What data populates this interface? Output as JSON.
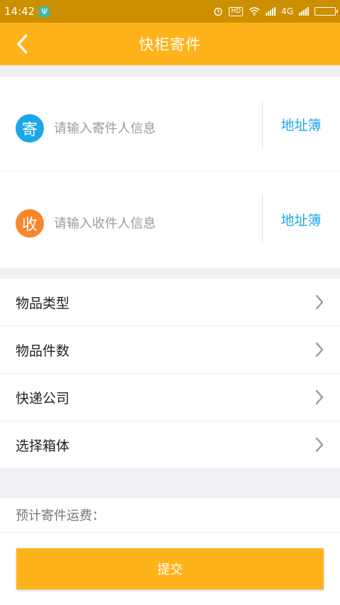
{
  "status_bar": {
    "time": "14:42",
    "hd_badge": "HD",
    "network": "4G",
    "icons": [
      "usb-icon",
      "alarm-icon",
      "hd-icon",
      "wifi-icon",
      "signal-icon",
      "signal-icon",
      "battery-charging-icon"
    ]
  },
  "nav": {
    "title": "快柜寄件",
    "back_icon": "chevron-left-icon"
  },
  "sender": {
    "badge": "寄",
    "placeholder": "请输入寄件人信息",
    "address_book": "地址簿",
    "color": "#1ba7ea"
  },
  "receiver": {
    "badge": "收",
    "placeholder": "请输入收件人信息",
    "address_book": "地址簿",
    "color": "#f7862d"
  },
  "menu": {
    "items": [
      {
        "label": "物品类型"
      },
      {
        "label": "物品件数"
      },
      {
        "label": "快递公司"
      },
      {
        "label": "选择箱体"
      }
    ]
  },
  "estimate": {
    "label": "预计寄件运费："
  },
  "submit": {
    "label": "提交"
  },
  "colors": {
    "accent": "#ffb31a",
    "status_bar": "#cc8f00",
    "link": "#1ba7ea"
  }
}
